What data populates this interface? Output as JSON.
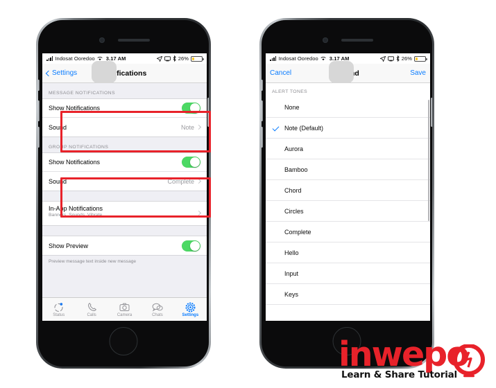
{
  "page": {
    "background_color": "#ffffff",
    "accent_blue": "#0a7cff",
    "toggle_green": "#4cd964",
    "annotation_red": "#e8222a"
  },
  "status_bar": {
    "carrier": "Indosat Ooredoo",
    "time": "3.17 AM",
    "battery_percent": "26%",
    "icons": [
      "signal-bars-icon",
      "wifi-icon",
      "location-arrow-icon",
      "screen-mirroring-icon",
      "bluetooth-icon",
      "battery-icon"
    ]
  },
  "phone_left": {
    "nav": {
      "back_label": "Settings",
      "title": "Notifications"
    },
    "sections": [
      {
        "header": "MESSAGE NOTIFICATIONS",
        "rows": [
          {
            "label": "Show Notifications",
            "type": "toggle",
            "value": "on"
          },
          {
            "label": "Sound",
            "type": "disclosure",
            "value": "Note"
          }
        ]
      },
      {
        "header": "GROUP NOTIFICATIONS",
        "rows": [
          {
            "label": "Show Notifications",
            "type": "toggle",
            "value": "on"
          },
          {
            "label": "Sound",
            "type": "disclosure",
            "value": "Complete"
          }
        ]
      }
    ],
    "in_app": {
      "label": "In-App Notifications",
      "sublabel": "Banners, Sounds, Vibrate"
    },
    "preview": {
      "label": "Show Preview",
      "value": "on",
      "footnote": "Preview message text inside new message"
    },
    "tabs": [
      {
        "label": "Status",
        "icon": "status-circle-icon",
        "active": false
      },
      {
        "label": "Calls",
        "icon": "phone-icon",
        "active": false
      },
      {
        "label": "Camera",
        "icon": "camera-icon",
        "active": false
      },
      {
        "label": "Chats",
        "icon": "chat-bubbles-icon",
        "active": false
      },
      {
        "label": "Settings",
        "icon": "gear-icon",
        "active": true
      }
    ]
  },
  "phone_right": {
    "nav": {
      "cancel_label": "Cancel",
      "title": "Sound",
      "save_label": "Save"
    },
    "section_header": "ALERT TONES",
    "tones": [
      {
        "label": "None",
        "selected": false
      },
      {
        "label": "Note (Default)",
        "selected": true
      },
      {
        "label": "Aurora",
        "selected": false
      },
      {
        "label": "Bamboo",
        "selected": false
      },
      {
        "label": "Chord",
        "selected": false
      },
      {
        "label": "Circles",
        "selected": false
      },
      {
        "label": "Complete",
        "selected": false
      },
      {
        "label": "Hello",
        "selected": false
      },
      {
        "label": "Input",
        "selected": false
      },
      {
        "label": "Keys",
        "selected": false
      }
    ]
  },
  "annotations": [
    {
      "name": "message-notifications-highlight"
    },
    {
      "name": "group-notifications-highlight"
    }
  ],
  "logo": {
    "word": "inwepo",
    "tagline": "Learn & Share Tutorial"
  }
}
